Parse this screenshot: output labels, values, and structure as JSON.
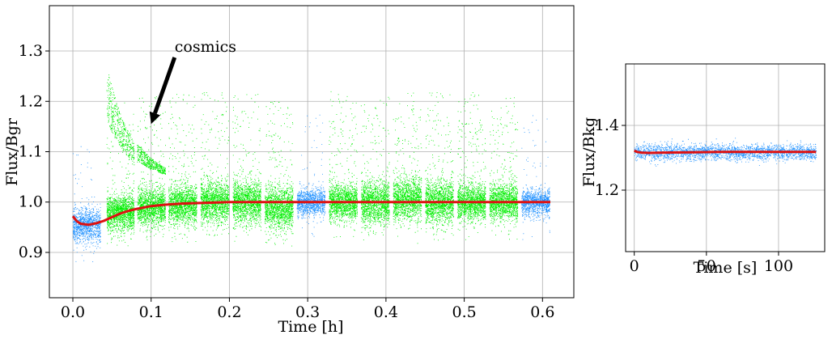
{
  "chart_data": [
    {
      "type": "scatter",
      "title": "",
      "xlabel": "Time [h]",
      "ylabel": "Flux/Bgr",
      "xlim": [
        -0.03,
        0.64
      ],
      "ylim": [
        0.81,
        1.39
      ],
      "xticks": [
        0.0,
        0.1,
        0.2,
        0.3,
        0.4,
        0.5,
        0.6
      ],
      "xtick_labels": [
        "0.0",
        "0.1",
        "0.2",
        "0.3",
        "0.4",
        "0.5",
        "0.6"
      ],
      "yticks": [
        0.9,
        1.0,
        1.1,
        1.2,
        1.3
      ],
      "ytick_labels": [
        "0.9",
        "1.0",
        "1.1",
        "1.2",
        "1.3"
      ],
      "grid": true,
      "colors": {
        "blue_points": "#1e90ff",
        "green_points": "#00ee00",
        "model": "#dd1111"
      },
      "segments": [
        {
          "x0": 0.0,
          "x1": 0.035,
          "center": 0.955,
          "spread": 0.03,
          "color": "blue"
        },
        {
          "x0": 0.043,
          "x1": 0.078,
          "center": 0.98,
          "spread": 0.03,
          "color": "green"
        },
        {
          "x0": 0.082,
          "x1": 0.118,
          "center": 0.99,
          "spread": 0.03,
          "color": "green"
        },
        {
          "x0": 0.122,
          "x1": 0.158,
          "center": 0.995,
          "spread": 0.032,
          "color": "green"
        },
        {
          "x0": 0.163,
          "x1": 0.199,
          "center": 1.0,
          "spread": 0.035,
          "color": "green"
        },
        {
          "x0": 0.204,
          "x1": 0.24,
          "center": 1.0,
          "spread": 0.035,
          "color": "green"
        },
        {
          "x0": 0.245,
          "x1": 0.281,
          "center": 0.99,
          "spread": 0.035,
          "color": "green"
        },
        {
          "x0": 0.286,
          "x1": 0.322,
          "center": 1.0,
          "spread": 0.022,
          "color": "blue"
        },
        {
          "x0": 0.327,
          "x1": 0.363,
          "center": 1.0,
          "spread": 0.03,
          "color": "green"
        },
        {
          "x0": 0.368,
          "x1": 0.404,
          "center": 1.0,
          "spread": 0.035,
          "color": "green"
        },
        {
          "x0": 0.409,
          "x1": 0.445,
          "center": 1.005,
          "spread": 0.035,
          "color": "green"
        },
        {
          "x0": 0.45,
          "x1": 0.486,
          "center": 1.0,
          "spread": 0.035,
          "color": "green"
        },
        {
          "x0": 0.491,
          "x1": 0.527,
          "center": 1.0,
          "spread": 0.03,
          "color": "green"
        },
        {
          "x0": 0.532,
          "x1": 0.568,
          "center": 1.0,
          "spread": 0.028,
          "color": "green"
        },
        {
          "x0": 0.573,
          "x1": 0.609,
          "center": 1.0,
          "spread": 0.022,
          "color": "blue"
        }
      ],
      "model_curve": {
        "x": [
          0.0,
          0.005,
          0.01,
          0.02,
          0.03,
          0.04,
          0.05,
          0.06,
          0.07,
          0.08,
          0.09,
          0.1,
          0.12,
          0.14,
          0.16,
          0.18,
          0.2,
          0.25,
          0.3,
          0.35,
          0.4,
          0.45,
          0.5,
          0.55,
          0.6,
          0.61
        ],
        "y": [
          0.972,
          0.962,
          0.957,
          0.955,
          0.958,
          0.963,
          0.97,
          0.977,
          0.982,
          0.986,
          0.989,
          0.992,
          0.995,
          0.997,
          0.998,
          0.999,
          1.0,
          1.0,
          1.0,
          1.0,
          1.0,
          1.0,
          1.0,
          1.0,
          1.0,
          1.0
        ]
      },
      "annotations": [
        {
          "text": "cosmics",
          "text_x": 0.13,
          "text_y": 1.3,
          "arrow_to_x": 0.1,
          "arrow_to_y": 1.155
        }
      ]
    },
    {
      "type": "scatter",
      "title": "",
      "xlabel": "Time [s]",
      "ylabel": "Flux/Bkg",
      "xlim": [
        -6,
        132
      ],
      "ylim": [
        1.01,
        1.59
      ],
      "xticks": [
        0,
        50,
        100
      ],
      "xtick_labels": [
        "0",
        "50",
        "100"
      ],
      "yticks": [
        1.2,
        1.4
      ],
      "ytick_labels": [
        "1.2",
        "1.4"
      ],
      "grid": true,
      "colors": {
        "points": "#1e90ff",
        "model": "#dd1111"
      },
      "points_summary": {
        "x0": 0,
        "x1": 126,
        "center": 1.318,
        "spread": 0.018
      },
      "model_curve": {
        "x": [
          0,
          2,
          5,
          10,
          20,
          40,
          60,
          80,
          100,
          126
        ],
        "y": [
          1.322,
          1.318,
          1.316,
          1.315,
          1.316,
          1.317,
          1.318,
          1.318,
          1.318,
          1.318
        ]
      }
    }
  ]
}
